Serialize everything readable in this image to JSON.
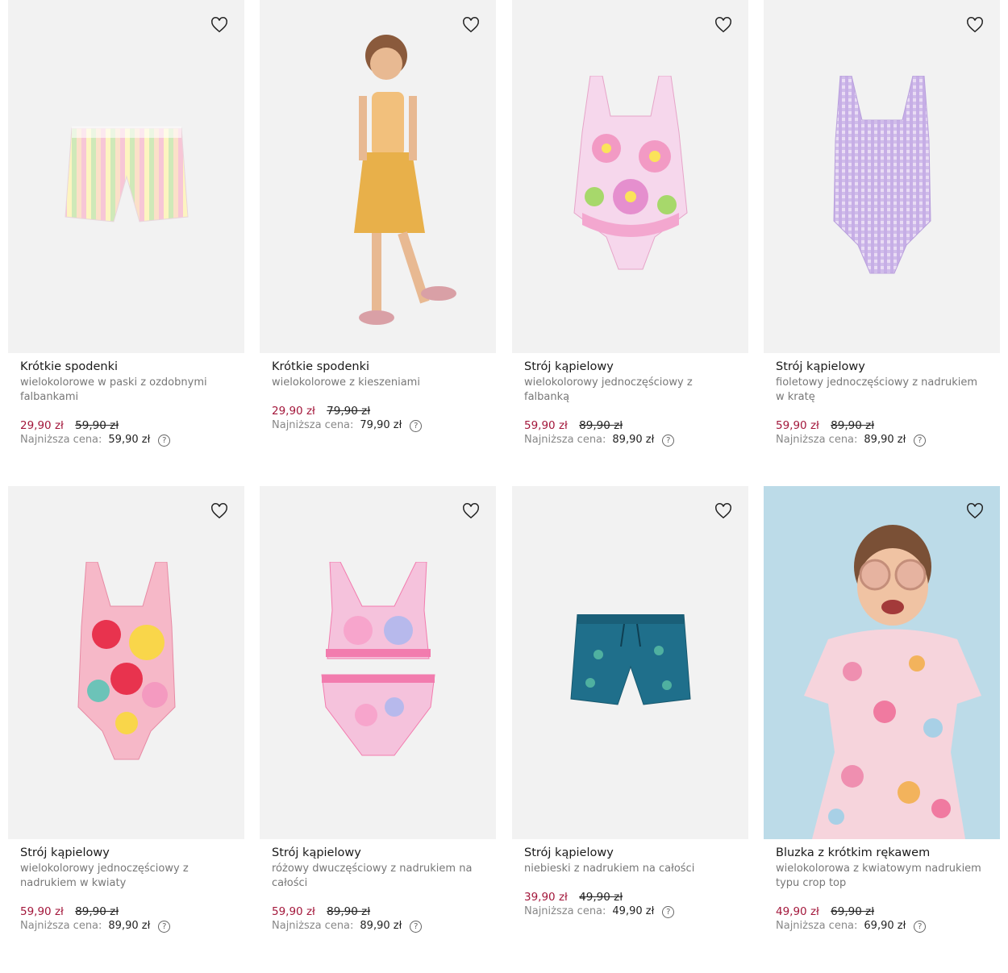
{
  "products": [
    {
      "title": "Krótkie spodenki",
      "desc": "wielokolorowe w paski z ozdobnymi falbankami",
      "price": "29,90 zł",
      "old_price": "59,90 zł",
      "lowest_label": "Najniższa cena:",
      "lowest_value": "59,90 zł",
      "image_icon": "striped-shorts-icon"
    },
    {
      "title": "Krótkie spodenki",
      "desc": "wielokolorowe z kieszeniami",
      "price": "29,90 zł",
      "old_price": "79,90 zł",
      "lowest_label": "Najniższa cena:",
      "lowest_value": "79,90 zł",
      "image_icon": "girl-model-icon"
    },
    {
      "title": "Strój kąpielowy",
      "desc": "wielokolorowy jednoczęściowy z falbanką",
      "price": "59,90 zł",
      "old_price": "89,90 zł",
      "lowest_label": "Najniższa cena:",
      "lowest_value": "89,90 zł",
      "image_icon": "floral-swimsuit-icon"
    },
    {
      "title": "Strój kąpielowy",
      "desc": "fioletowy jednoczęściowy z nadrukiem w kratę",
      "price": "59,90 zł",
      "old_price": "89,90 zł",
      "lowest_label": "Najniższa cena:",
      "lowest_value": "89,90 zł",
      "image_icon": "gingham-swimsuit-icon"
    },
    {
      "title": "Strój kąpielowy",
      "desc": "wielokolorowy jednoczęściowy z nadrukiem w kwiaty",
      "price": "59,90 zł",
      "old_price": "89,90 zł",
      "lowest_label": "Najniższa cena:",
      "lowest_value": "89,90 zł",
      "image_icon": "flower-swimsuit-icon"
    },
    {
      "title": "Strój kąpielowy",
      "desc": "różowy dwuczęściowy z nadrukiem na całości",
      "price": "59,90 zł",
      "old_price": "89,90 zł",
      "lowest_label": "Najniższa cena:",
      "lowest_value": "89,90 zł",
      "image_icon": "bikini-icon"
    },
    {
      "title": "Strój kąpielowy",
      "desc": "niebieski z nadrukiem na całości",
      "price": "39,90 zł",
      "old_price": "49,90 zł",
      "lowest_label": "Najniższa cena:",
      "lowest_value": "49,90 zł",
      "image_icon": "swim-shorts-icon"
    },
    {
      "title": "Bluzka z krótkim rękawem",
      "desc": "wielokolorowa z kwiatowym nadrukiem typu crop top",
      "price": "49,90 zł",
      "old_price": "69,90 zł",
      "lowest_label": "Najniższa cena:",
      "lowest_value": "69,90 zł",
      "image_icon": "girl-sunglasses-icon"
    }
  ],
  "colors": {
    "sale": "#a3173b",
    "image_bg": "#f2f2f2",
    "blue_bg": "#bcdbe8"
  }
}
